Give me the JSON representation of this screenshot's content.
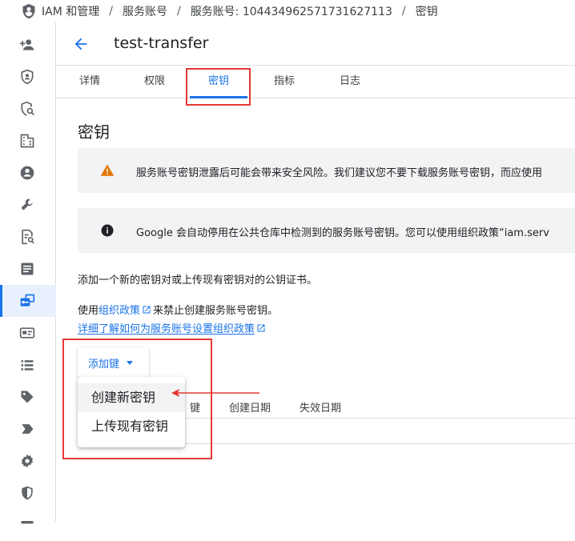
{
  "breadcrumb": {
    "items": [
      "IAM 和管理",
      "服务账号",
      "服务账号: 104434962571731627113",
      "密钥"
    ],
    "separator": "/"
  },
  "sidebar": {
    "items": [
      {
        "icon": "person-add-icon"
      },
      {
        "icon": "shield-account-icon"
      },
      {
        "icon": "security-search-icon"
      },
      {
        "icon": "building-icon"
      },
      {
        "icon": "account-circle-icon"
      },
      {
        "icon": "wrench-icon"
      },
      {
        "icon": "document-search-icon"
      },
      {
        "icon": "article-icon"
      },
      {
        "icon": "service-account-key-icon",
        "active": true
      },
      {
        "icon": "id-card-icon"
      },
      {
        "icon": "list-icon"
      },
      {
        "icon": "tag-icon"
      },
      {
        "icon": "label-arrow-icon"
      },
      {
        "icon": "settings-gear-icon"
      },
      {
        "icon": "policy-shield-icon"
      },
      {
        "icon": "more-icon"
      }
    ]
  },
  "header": {
    "title": "test-transfer"
  },
  "tabs": [
    {
      "label": "详情"
    },
    {
      "label": "权限"
    },
    {
      "label": "密钥",
      "active": true
    },
    {
      "label": "指标"
    },
    {
      "label": "日志"
    }
  ],
  "section_title": "密钥",
  "warning_banner": {
    "text": "服务账号密钥泄露后可能会带来安全风险。我们建议您不要下载服务账号密钥，而应使用"
  },
  "info_banner": {
    "text": "Google 会自动停用在公共仓库中检测到的服务账号密钥。您可以使用组织政策“iam.serv"
  },
  "intro_text": "添加一个新的密钥对或上传现有密钥对的公钥证书。",
  "policy_line": {
    "prefix": "使用",
    "link": "组织政策",
    "suffix": "来禁止创建服务账号密钥。"
  },
  "learn_link": "详细了解如何为服务账号设置组织政策",
  "add_key_button": "添加键",
  "table": {
    "columns": [
      "键",
      "创建日期",
      "失效日期"
    ]
  },
  "dropdown": {
    "items": [
      "创建新密钥",
      "上传现有密钥"
    ],
    "highlighted": 0
  },
  "colors": {
    "accent": "#1a73e8",
    "annotation": "#e53935",
    "warning": "#e37400"
  }
}
